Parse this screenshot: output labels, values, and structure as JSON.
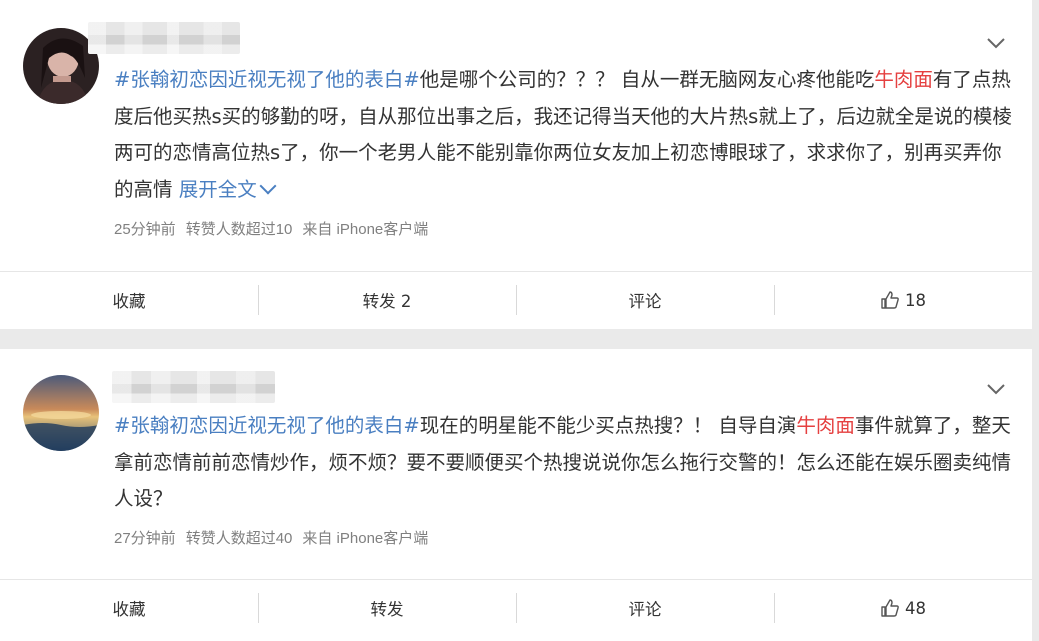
{
  "posts": [
    {
      "topic": "#张翰初恋因近视无视了他的表白#",
      "text_parts": [
        "他是哪个公司的？？？ 自从一群无脑网友心疼他能吃",
        "牛肉面",
        "有了点热度后他买热s买的够勤的呀，自从那位出事之后，我还记得当天他的大片热s就上了，后边就全是说的模棱两可的恋情高位热s了，你一个老男人能不能别靠你两位女友加上初恋博眼球了，求求你了，别再买弄你的高情"
      ],
      "expand_label": "展开全文",
      "meta": {
        "time": "25分钟前",
        "reposts_info": "转赞人数超过10",
        "source": "来自 iPhone客户端"
      },
      "actions": {
        "favorite": "收藏",
        "repost": "转发 2",
        "comment": "评论",
        "like": "18"
      }
    },
    {
      "topic": "#张翰初恋因近视无视了他的表白#",
      "text_parts": [
        "现在的明星能不能少买点热搜？！ 自导自演",
        "牛肉面",
        "事件就算了，整天拿前恋情前前恋情炒作，烦不烦？要不要顺便买个热搜说说你怎么拖行交警的！怎么还能在娱乐圈卖纯情人设？"
      ],
      "meta": {
        "time": "27分钟前",
        "reposts_info": "转赞人数超过40",
        "source": "来自 iPhone客户端"
      },
      "actions": {
        "favorite": "收藏",
        "repost": "转发",
        "comment": "评论",
        "like": "48"
      }
    }
  ],
  "colors": {
    "topic": "#4a7fc1",
    "highlight": "#e54040",
    "meta": "#808080",
    "background": "#eaeaea"
  },
  "icons": [
    "chevron-down-icon",
    "thumbs-up-icon"
  ]
}
